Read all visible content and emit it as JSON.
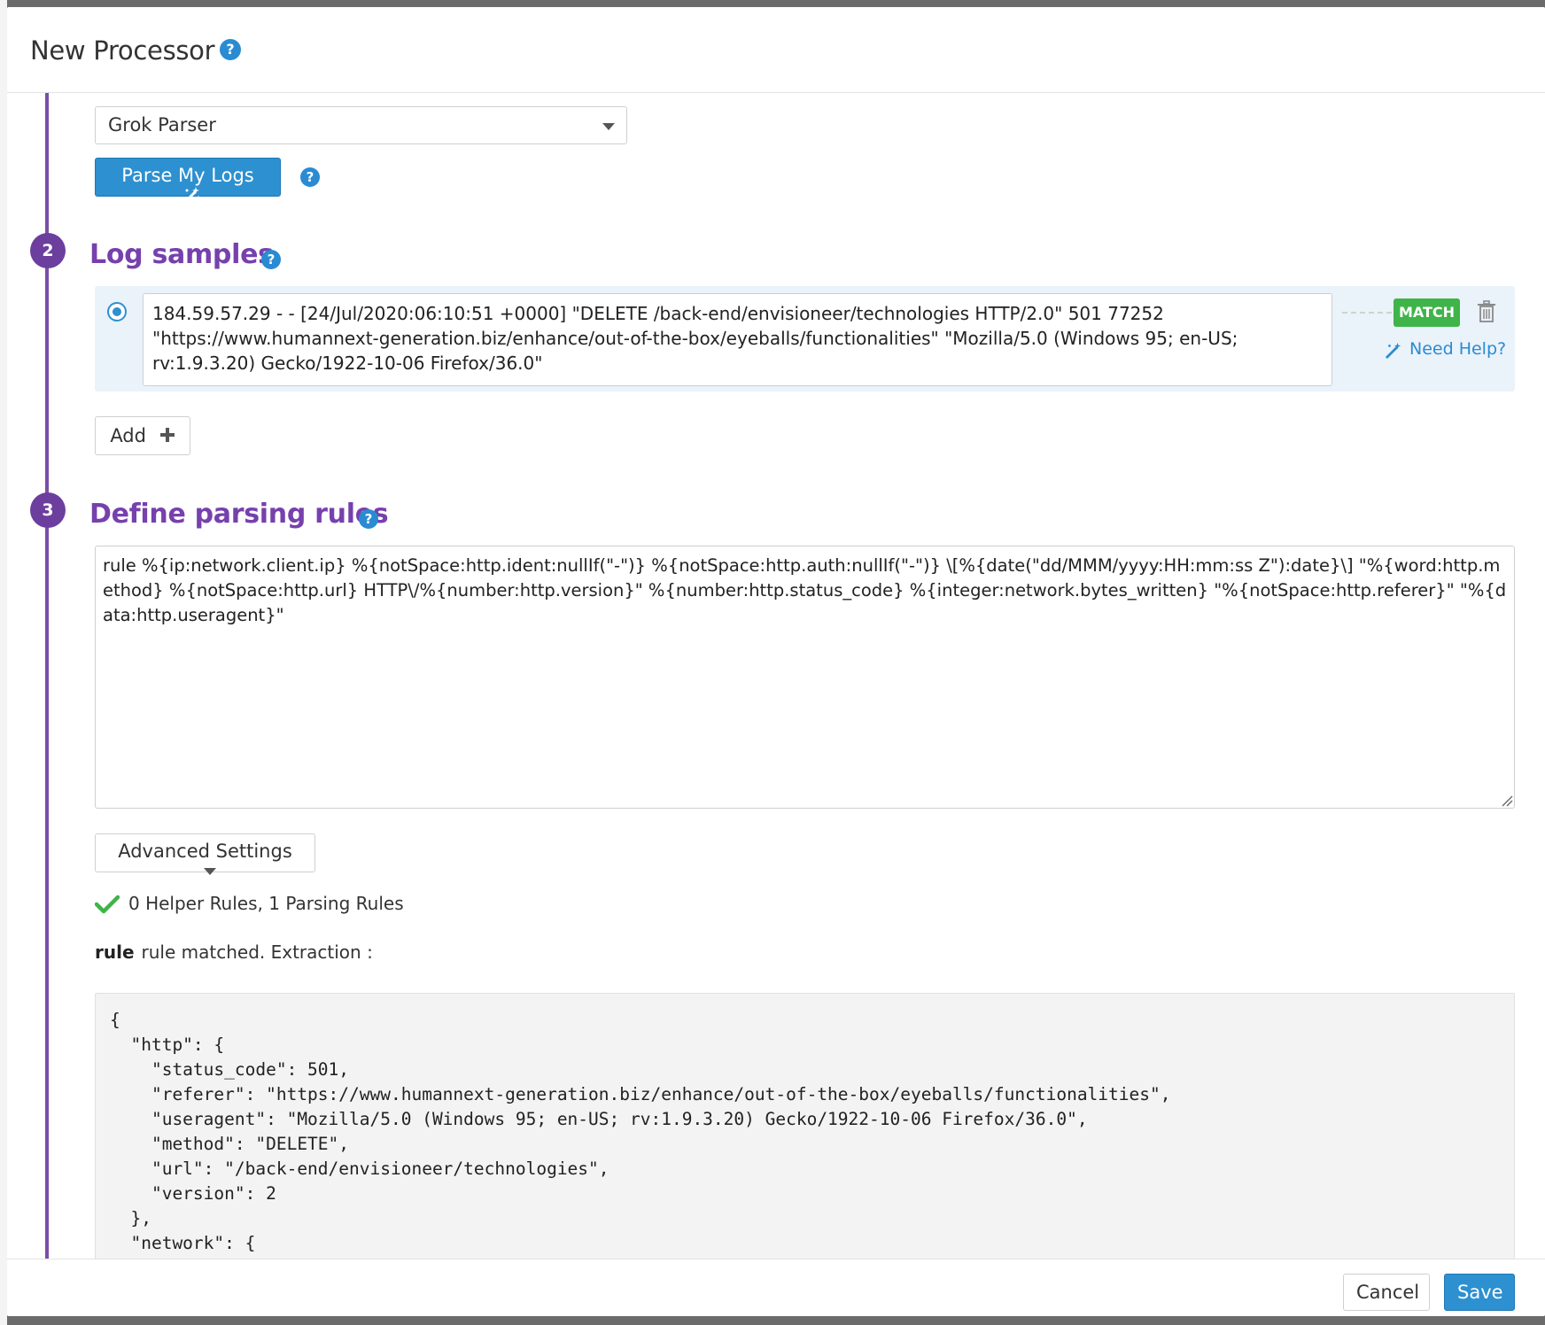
{
  "header": {
    "title": "New Processor",
    "help_glyph": "?"
  },
  "processor_type": {
    "selected": "Grok Parser",
    "caret": "chevron-down-icon"
  },
  "parse_button": {
    "label": "Parse My Logs",
    "icon": "magic-wand-icon"
  },
  "steps": {
    "log_samples": {
      "number": "2",
      "title": "Log samples"
    },
    "parsing_rules": {
      "number": "3",
      "title": "Define parsing rules"
    }
  },
  "log_sample": {
    "text": "184.59.57.29 - - [24/Jul/2020:06:10:51 +0000] \"DELETE /back-end/envisioneer/technologies HTTP/2.0\" 501 77252 \"https://www.humannext-generation.biz/enhance/out-of-the-box/eyeballs/functionalities\" \"Mozilla/5.0 (Windows 95; en-US; rv:1.9.3.20) Gecko/1922-10-06 Firefox/36.0\"",
    "status": "MATCH",
    "need_help": "Need Help?"
  },
  "add_button": {
    "label": "Add"
  },
  "parsing_rule": {
    "text": "rule %{ip:network.client.ip} %{notSpace:http.ident:nullIf(\"-\")} %{notSpace:http.auth:nullIf(\"-\")} \\[%{date(\"dd/MMM/yyyy:HH:mm:ss Z\"):date}\\] \"%{word:http.method} %{notSpace:http.url} HTTP\\/%{number:http.version}\" %{number:http.status_code} %{integer:network.bytes_written} \"%{notSpace:http.referer}\" \"%{data:http.useragent}\""
  },
  "advanced_settings": {
    "label": "Advanced Settings"
  },
  "validation": {
    "summary": "0 Helper Rules, 1 Parsing Rules",
    "rule_name": "rule",
    "match_text": "rule matched. Extraction :"
  },
  "extraction": {
    "json": "{\n  \"http\": {\n    \"status_code\": 501,\n    \"referer\": \"https://www.humannext-generation.biz/enhance/out-of-the-box/eyeballs/functionalities\",\n    \"useragent\": \"Mozilla/5.0 (Windows 95; en-US; rv:1.9.3.20) Gecko/1922-10-06 Firefox/36.0\",\n    \"method\": \"DELETE\",\n    \"url\": \"/back-end/envisioneer/technologies\",\n    \"version\": 2\n  },\n  \"network\": {"
  },
  "footer": {
    "cancel_label": "Cancel",
    "save_label": "Save"
  },
  "colors": {
    "accent_blue": "#2d90d0",
    "step_purple": "#6c3e9e",
    "match_green": "#3fb449"
  }
}
